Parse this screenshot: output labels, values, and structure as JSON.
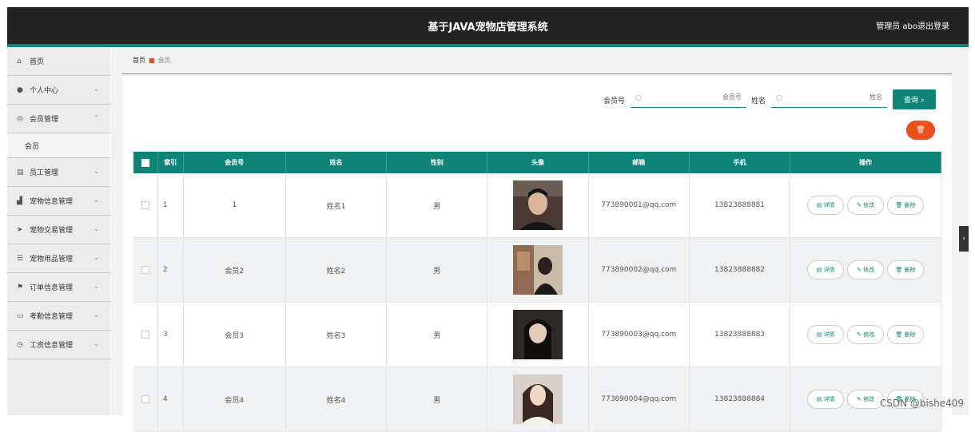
{
  "header": {
    "title": "基于JAVA宠物店管理系统",
    "user": "管理员 abo",
    "logout": "退出登录"
  },
  "sidebar": {
    "items": [
      {
        "label": "首页",
        "icon": "home-icon",
        "glyph": "⌂",
        "chev": ""
      },
      {
        "label": "个人中心",
        "icon": "user-icon",
        "glyph": "●",
        "chev": "⌄"
      },
      {
        "label": "会员管理",
        "icon": "member-icon",
        "glyph": "◎",
        "chev": "⌃"
      },
      {
        "label": "员工管理",
        "icon": "staff-icon",
        "glyph": "▤",
        "chev": "⌄"
      },
      {
        "label": "宠物信息管理",
        "icon": "pet-info-icon",
        "glyph": "▟",
        "chev": "⌄"
      },
      {
        "label": "宠物交易管理",
        "icon": "send-icon",
        "glyph": "➤",
        "chev": "⌄"
      },
      {
        "label": "宠物用品管理",
        "icon": "list-icon",
        "glyph": "☰",
        "chev": "⌄"
      },
      {
        "label": "订单信息管理",
        "icon": "flag-icon",
        "glyph": "⚑",
        "chev": "⌄"
      },
      {
        "label": "考勤信息管理",
        "icon": "chat-icon",
        "glyph": "▭",
        "chev": "⌄"
      },
      {
        "label": "工资信息管理",
        "icon": "clock-icon",
        "glyph": "◷",
        "chev": "⌄"
      }
    ],
    "sub_item": "会员"
  },
  "breadcrumb": {
    "home": "首页",
    "current": "会员"
  },
  "search": {
    "member_label": "会员号",
    "member_placeholder": "会员号",
    "name_label": "姓名",
    "name_placeholder": "姓名",
    "query_label": "查询 ⌕",
    "delete_icon": "🗑"
  },
  "table": {
    "headers": [
      "索引",
      "会员号",
      "姓名",
      "性别",
      "头像",
      "邮箱",
      "手机",
      "操作"
    ],
    "actions": {
      "detail": "▤ 详情",
      "edit": "✎ 修改",
      "delete": "🗑 删除"
    },
    "rows": [
      {
        "index": "1",
        "member_no": "1",
        "name": "姓名1",
        "gender": "男",
        "email": "773890001@qq.com",
        "phone": "13823888881"
      },
      {
        "index": "2",
        "member_no": "会员2",
        "name": "姓名2",
        "gender": "男",
        "email": "773890002@qq.com",
        "phone": "13823888882"
      },
      {
        "index": "3",
        "member_no": "会员3",
        "name": "姓名3",
        "gender": "男",
        "email": "773890003@qq.com",
        "phone": "13823888883"
      },
      {
        "index": "4",
        "member_no": "会员4",
        "name": "姓名4",
        "gender": "男",
        "email": "773890004@qq.com",
        "phone": "13823888884"
      }
    ]
  },
  "watermark": "CSDN @bishe409",
  "colors": {
    "accent": "#0f8577",
    "danger": "#e8501f",
    "header_bg": "#232323"
  }
}
